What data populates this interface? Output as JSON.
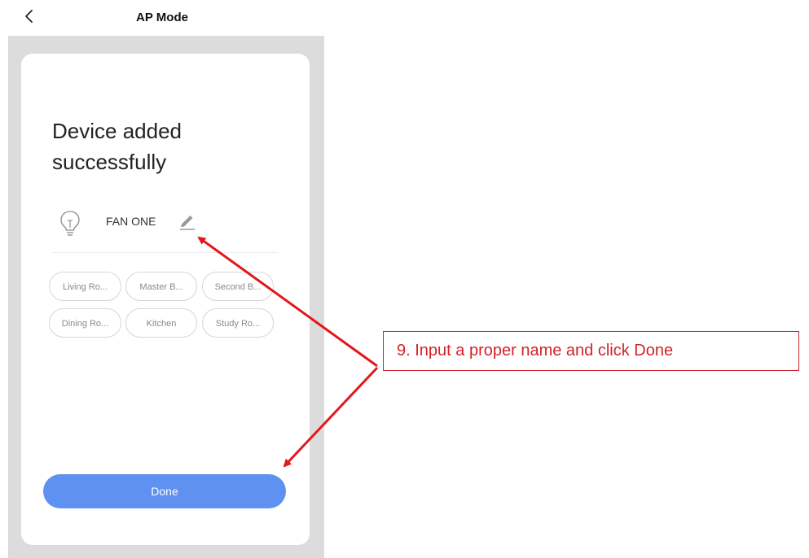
{
  "header": {
    "title": "AP Mode",
    "back_icon": "chevron-left-icon"
  },
  "card": {
    "heading": "Device added successfully",
    "device": {
      "icon": "light-bulb-icon",
      "name": "FAN ONE",
      "edit_icon": "pencil-icon"
    },
    "rooms": [
      "Living Ro...",
      "Master B...",
      "Second B...",
      "Dining Ro...",
      "Kitchen",
      "Study Ro..."
    ],
    "done_label": "Done"
  },
  "annotation": {
    "text": "9. Input a proper name and click Done",
    "color": "#d3232a"
  },
  "colors": {
    "accent": "#5f92f0",
    "backdrop": "#dcdcdc",
    "arrow": "#e3171d"
  }
}
